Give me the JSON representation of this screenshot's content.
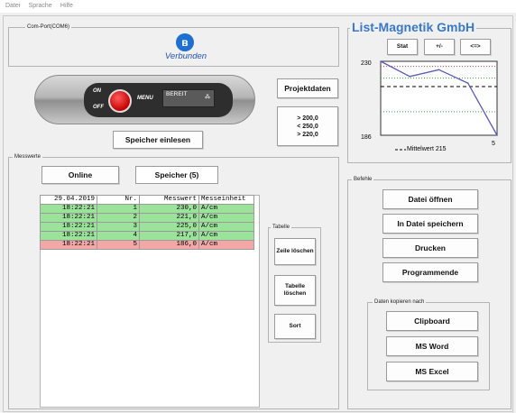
{
  "menu": [
    "Datei",
    "Sprache",
    "Hilfe"
  ],
  "com_port": {
    "legend": "Com-Port(COM6)",
    "icon": "bluetooth-icon",
    "status": "Verbunden",
    "color": "#1f52b8"
  },
  "device": {
    "on": "ON",
    "off": "OFF",
    "menu": "MENU",
    "screen": "BEREIT",
    "screen_symbol": "⁂"
  },
  "buttons": {
    "projektdaten": "Projektdaten",
    "thresholds": [
      "> 200,0",
      "< 250,0",
      "> 220,0"
    ],
    "speicher_einlesen": "Speicher einlesen"
  },
  "messwerte": {
    "legend": "Messwerte",
    "tabs": [
      "Online",
      "Speicher (5)"
    ],
    "table": {
      "headers": [
        "29.04.2019",
        "Nr.",
        "Messwert",
        "Messeinheit"
      ],
      "rows": [
        {
          "time": "18:22:21",
          "nr": "1",
          "value": "230,0",
          "unit": "A/cm",
          "status": "ok"
        },
        {
          "time": "18:22:21",
          "nr": "2",
          "value": "221,0",
          "unit": "A/cm",
          "status": "ok"
        },
        {
          "time": "18:22:21",
          "nr": "3",
          "value": "225,0",
          "unit": "A/cm",
          "status": "ok"
        },
        {
          "time": "18:22:21",
          "nr": "4",
          "value": "217,0",
          "unit": "A/cm",
          "status": "ok"
        },
        {
          "time": "18:22:21",
          "nr": "5",
          "value": "186,0",
          "unit": "A/cm",
          "status": "bad"
        }
      ]
    },
    "tabelle": {
      "legend": "Tabelle",
      "buttons": [
        "Zeile löschen",
        "Tabelle löschen",
        "Sort"
      ]
    }
  },
  "chart": {
    "title": "List-Magnetik GmbH",
    "buttons": [
      "Stat",
      "+/-",
      "<=>"
    ],
    "y_max_label": "230",
    "y_min_label": "186",
    "x_max_label": "5",
    "legend": "Mittelwert 215"
  },
  "chart_data": {
    "type": "line",
    "x": [
      1,
      2,
      3,
      4,
      5
    ],
    "series": [
      {
        "values": [
          230,
          221,
          225,
          217,
          186
        ]
      }
    ],
    "ylim": [
      186,
      230
    ],
    "mean": 215,
    "upper_limit": 227,
    "lower_limit": 200,
    "thresholds": [
      {
        "value": 227,
        "color": "#d04040"
      },
      {
        "value": 220,
        "color": "#40a040"
      },
      {
        "value": 200,
        "color": "#40a040"
      }
    ],
    "line_color": "#5a5ab4"
  },
  "befehle": {
    "legend": "Befehle",
    "buttons": [
      "Datei öffnen",
      "In Datei speichern",
      "Drucken",
      "Programmende"
    ],
    "copy_legend": "Daten kopieren nach",
    "copy_buttons": [
      "Clipboard",
      "MS Word",
      "MS Excel"
    ]
  },
  "colors": {
    "ok_row": "#9be39a",
    "bad_row": "#f4a7a7",
    "title": "#3a78c8"
  }
}
